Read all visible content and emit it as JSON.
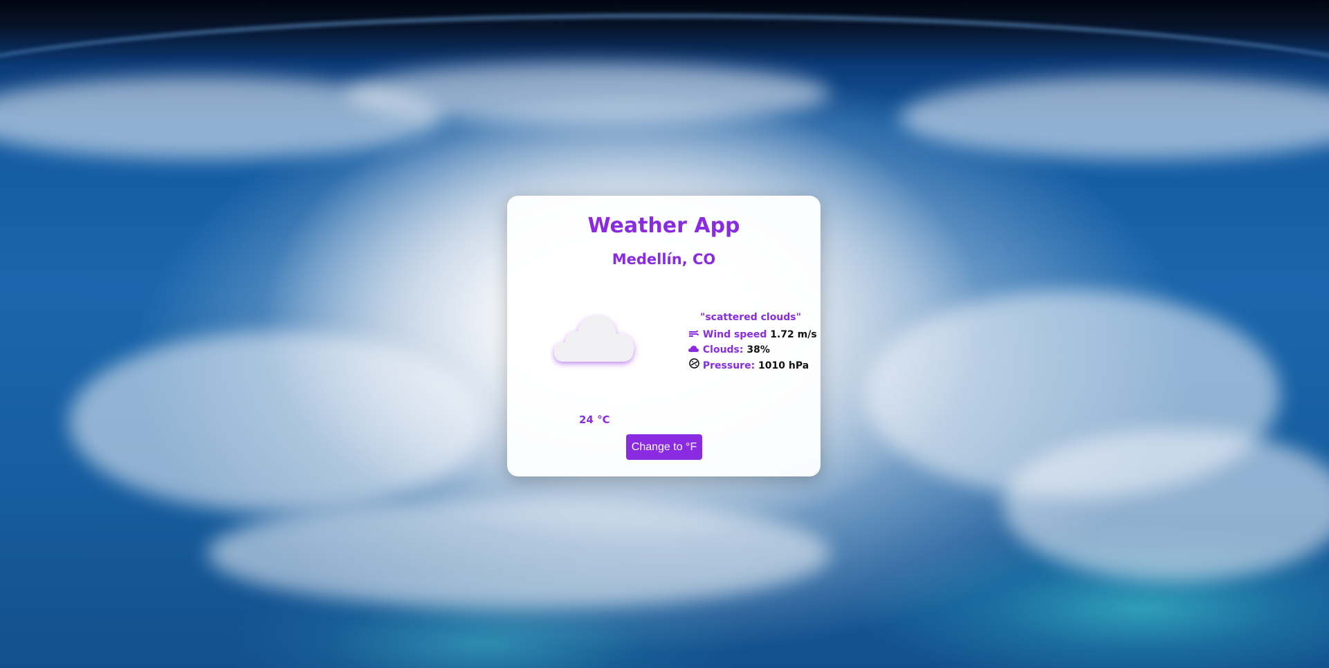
{
  "app": {
    "title": "Weather App",
    "city": "Medellín, CO"
  },
  "weather": {
    "description": "\"scattered clouds\"",
    "wind_label": "Wind speed",
    "wind_value": "1.72 m/s",
    "clouds_label": "Clouds:",
    "clouds_value": "38%",
    "pressure_label": "Pressure:",
    "pressure_value": "1010 hPa",
    "temperature": "24 °C",
    "icon": "cloud-icon"
  },
  "actions": {
    "toggle_unit_label": "Change to °F"
  },
  "colors": {
    "accent": "#8a2be2",
    "card": "#ffffff"
  }
}
